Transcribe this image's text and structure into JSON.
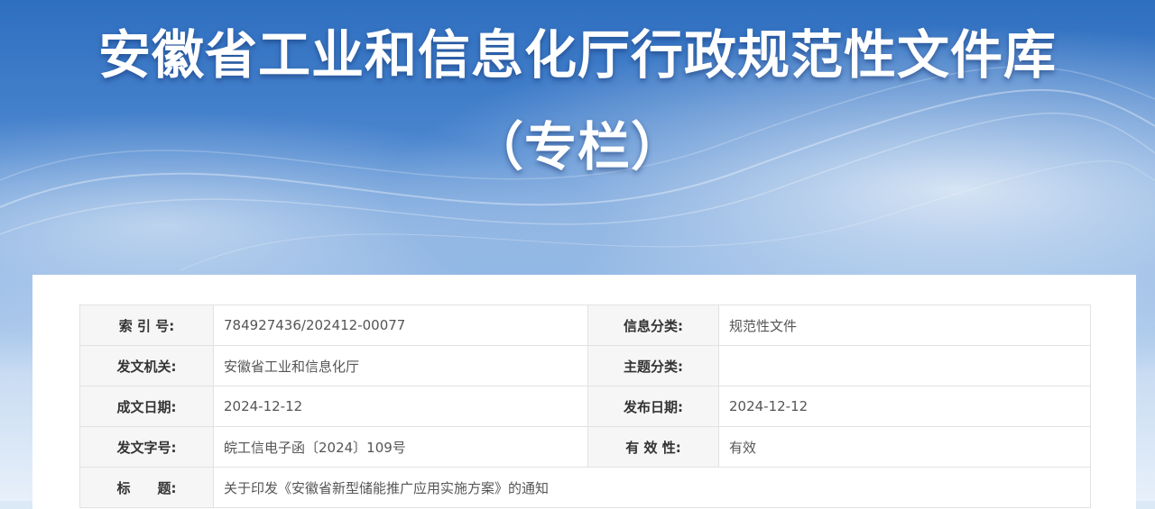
{
  "header": {
    "title_line1": "安徽省工业和信息化厅行政规范性文件库",
    "title_line2": "（专栏）"
  },
  "doc_info": {
    "index_no_label": "索 引 号:",
    "index_no": "784927436/202412-00077",
    "info_category_label": "信息分类:",
    "info_category": "规范性文件",
    "issuing_org_label": "发文机关:",
    "issuing_org": "安徽省工业和信息化厅",
    "subject_category_label": "主题分类:",
    "subject_category": "",
    "written_date_label": "成文日期:",
    "written_date": "2024-12-12",
    "publish_date_label": "发布日期:",
    "publish_date": "2024-12-12",
    "doc_number_label": "发文字号:",
    "doc_number": "皖工信电子函〔2024〕109号",
    "validity_label": "有 效 性:",
    "validity": "有效",
    "title_label": "标　　题:",
    "title": "关于印发《安徽省新型储能推广应用实施方案》的通知"
  },
  "colors": {
    "banner_top": "#2f6fc0",
    "banner_bottom": "#e7f0fa",
    "label_bg": "#f6f6f6",
    "border": "#e2e2e2"
  }
}
